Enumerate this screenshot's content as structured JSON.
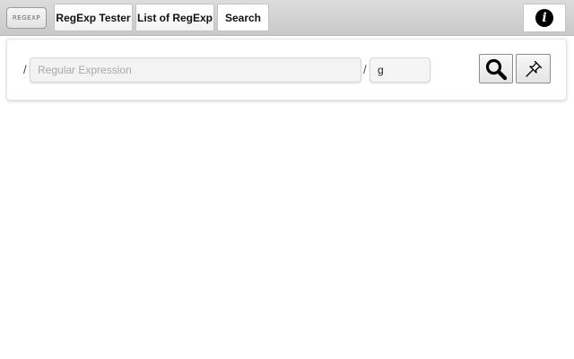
{
  "header": {
    "logo_text": "REGEXP",
    "nav": [
      {
        "label": "RegExp Tester"
      },
      {
        "label": "List of RegExp"
      },
      {
        "label": "Search"
      }
    ],
    "info_icon": "info-icon"
  },
  "tester": {
    "delimiter": "/",
    "regex": {
      "value": "",
      "placeholder": "Regular Expression"
    },
    "flags": {
      "value": "g",
      "placeholder": ""
    },
    "icons": {
      "search": "magnifier-icon",
      "pin": "pushpin-icon"
    }
  }
}
